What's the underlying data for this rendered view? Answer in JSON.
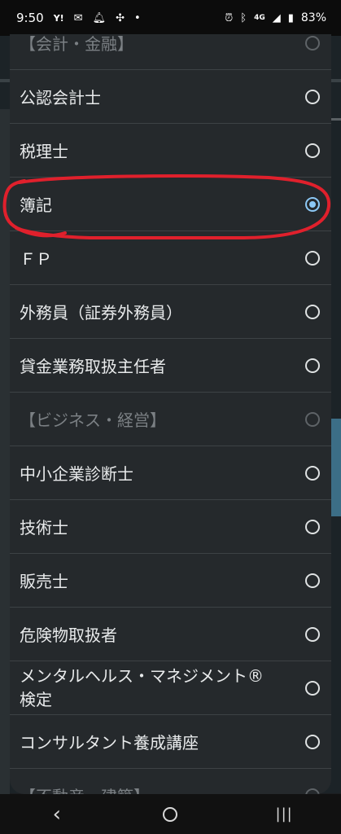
{
  "status_bar": {
    "time": "9:50",
    "left_icons": [
      "Y!",
      "mail-icon",
      "bell-icon",
      "fan-icon",
      "•"
    ],
    "right_icons": [
      "alarm-icon",
      "bluetooth-icon",
      "4G",
      "signal-icon",
      "battery-icon"
    ],
    "battery": "83%"
  },
  "options": [
    {
      "label": "【会計・金融】",
      "selected": false,
      "disabled": true
    },
    {
      "label": "公認会計士",
      "selected": false,
      "disabled": false
    },
    {
      "label": "税理士",
      "selected": false,
      "disabled": false
    },
    {
      "label": "簿記",
      "selected": true,
      "disabled": false
    },
    {
      "label": "ＦＰ",
      "selected": false,
      "disabled": false
    },
    {
      "label": "外務員（証券外務員）",
      "selected": false,
      "disabled": false
    },
    {
      "label": "貸金業務取扱主任者",
      "selected": false,
      "disabled": false
    },
    {
      "label": "【ビジネス・経営】",
      "selected": false,
      "disabled": true
    },
    {
      "label": "中小企業診断士",
      "selected": false,
      "disabled": false
    },
    {
      "label": "技術士",
      "selected": false,
      "disabled": false
    },
    {
      "label": "販売士",
      "selected": false,
      "disabled": false
    },
    {
      "label": "危険物取扱者",
      "selected": false,
      "disabled": false
    },
    {
      "label": "メンタルヘルス・マネジメント®\n検定",
      "selected": false,
      "disabled": false
    },
    {
      "label": "コンサルタント養成講座",
      "selected": false,
      "disabled": false
    },
    {
      "label": "【不動産・建築】",
      "selected": false,
      "disabled": true
    }
  ],
  "colors": {
    "selected_radio": "#8cc8f5",
    "annotation": "#e0202c"
  }
}
